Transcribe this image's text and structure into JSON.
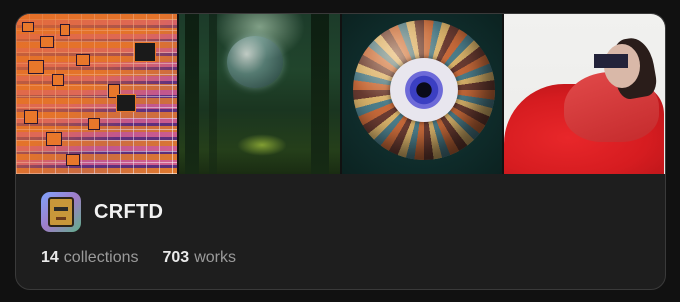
{
  "profile": {
    "name": "CRFTD",
    "avatar_icon": "pixel-avatar-icon"
  },
  "stats": {
    "collections_count": "14",
    "collections_label": "collections",
    "works_count": "703",
    "works_label": "works"
  },
  "thumbnails": [
    {
      "id": "thumb-1",
      "desc_icon": "mosaic-art"
    },
    {
      "id": "thumb-2",
      "desc_icon": "forest-bubble-art"
    },
    {
      "id": "thumb-3",
      "desc_icon": "eye-sphere-art"
    },
    {
      "id": "thumb-4",
      "desc_icon": "red-dress-art"
    }
  ],
  "colors": {
    "background": "#111111",
    "card": "#1e1e1e",
    "border": "#3a3a3a",
    "text_primary": "#f2f2f2",
    "text_secondary": "#9a9a9a"
  }
}
